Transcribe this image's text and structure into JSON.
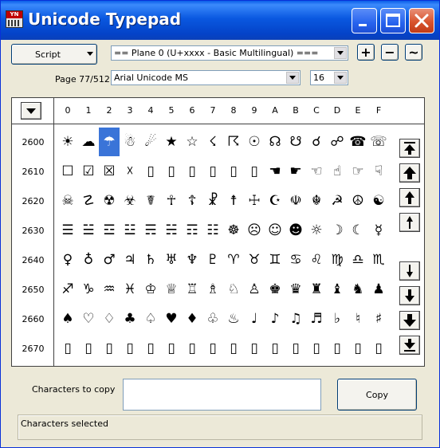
{
  "window": {
    "title": "Unicode Typepad",
    "icon_text": "YN"
  },
  "toolbar": {
    "script_button": "Script",
    "plane_value": "== Plane 0 (U+xxxx - Basic Multilingual) ===",
    "page_label": "Page 77/512",
    "font_value": "Arial Unicode MS",
    "size_value": "16",
    "plus_label": "+",
    "minus_label": "−",
    "wave_label": "~"
  },
  "grid": {
    "columns": [
      "0",
      "1",
      "2",
      "3",
      "4",
      "5",
      "6",
      "7",
      "8",
      "9",
      "A",
      "B",
      "C",
      "D",
      "E",
      "F"
    ],
    "rows": [
      {
        "label": "2600",
        "chars": [
          "☀",
          "☁",
          "☂",
          "☃",
          "☄",
          "★",
          "☆",
          "☇",
          "☈",
          "☉",
          "☊",
          "☋",
          "☌",
          "☍",
          "☎",
          "☏"
        ]
      },
      {
        "label": "2610",
        "chars": [
          "☐",
          "☑",
          "☒",
          "☓",
          "▯",
          "▯",
          "▯",
          "▯",
          "▯",
          "▯",
          "☚",
          "☛",
          "☜",
          "☝",
          "☞",
          "☟"
        ]
      },
      {
        "label": "2620",
        "chars": [
          "☠",
          "☡",
          "☢",
          "☣",
          "☤",
          "☥",
          "☦",
          "☧",
          "☨",
          "☩",
          "☪",
          "☫",
          "☬",
          "☭",
          "☮",
          "☯"
        ]
      },
      {
        "label": "2630",
        "chars": [
          "☰",
          "☱",
          "☲",
          "☳",
          "☴",
          "☵",
          "☶",
          "☷",
          "☸",
          "☹",
          "☺",
          "☻",
          "☼",
          "☽",
          "☾",
          "☿"
        ]
      },
      {
        "label": "2640",
        "chars": [
          "♀",
          "♁",
          "♂",
          "♃",
          "♄",
          "♅",
          "♆",
          "♇",
          "♈",
          "♉",
          "♊",
          "♋",
          "♌",
          "♍",
          "♎",
          "♏"
        ]
      },
      {
        "label": "2650",
        "chars": [
          "♐",
          "♑",
          "♒",
          "♓",
          "♔",
          "♕",
          "♖",
          "♗",
          "♘",
          "♙",
          "♚",
          "♛",
          "♜",
          "♝",
          "♞",
          "♟"
        ]
      },
      {
        "label": "2660",
        "chars": [
          "♠",
          "♡",
          "♢",
          "♣",
          "♤",
          "♥",
          "♦",
          "♧",
          "♨",
          "♩",
          "♪",
          "♫",
          "♬",
          "♭",
          "♮",
          "♯"
        ]
      },
      {
        "label": "2670",
        "chars": [
          "▯",
          "▯",
          "▯",
          "▯",
          "▯",
          "▯",
          "▯",
          "▯",
          "▯",
          "▯",
          "▯",
          "▯",
          "▯",
          "▯",
          "▯",
          "▯"
        ]
      }
    ],
    "selected": {
      "row": 0,
      "col": 2
    }
  },
  "bottom": {
    "copy_label": "Characters to copy",
    "copy_button": "Copy",
    "copy_value": "",
    "status_text": "Characters selected"
  },
  "colors": {
    "selection": "#3a74d8",
    "titlebar": "#0a58e0",
    "close": "#d8542e"
  }
}
